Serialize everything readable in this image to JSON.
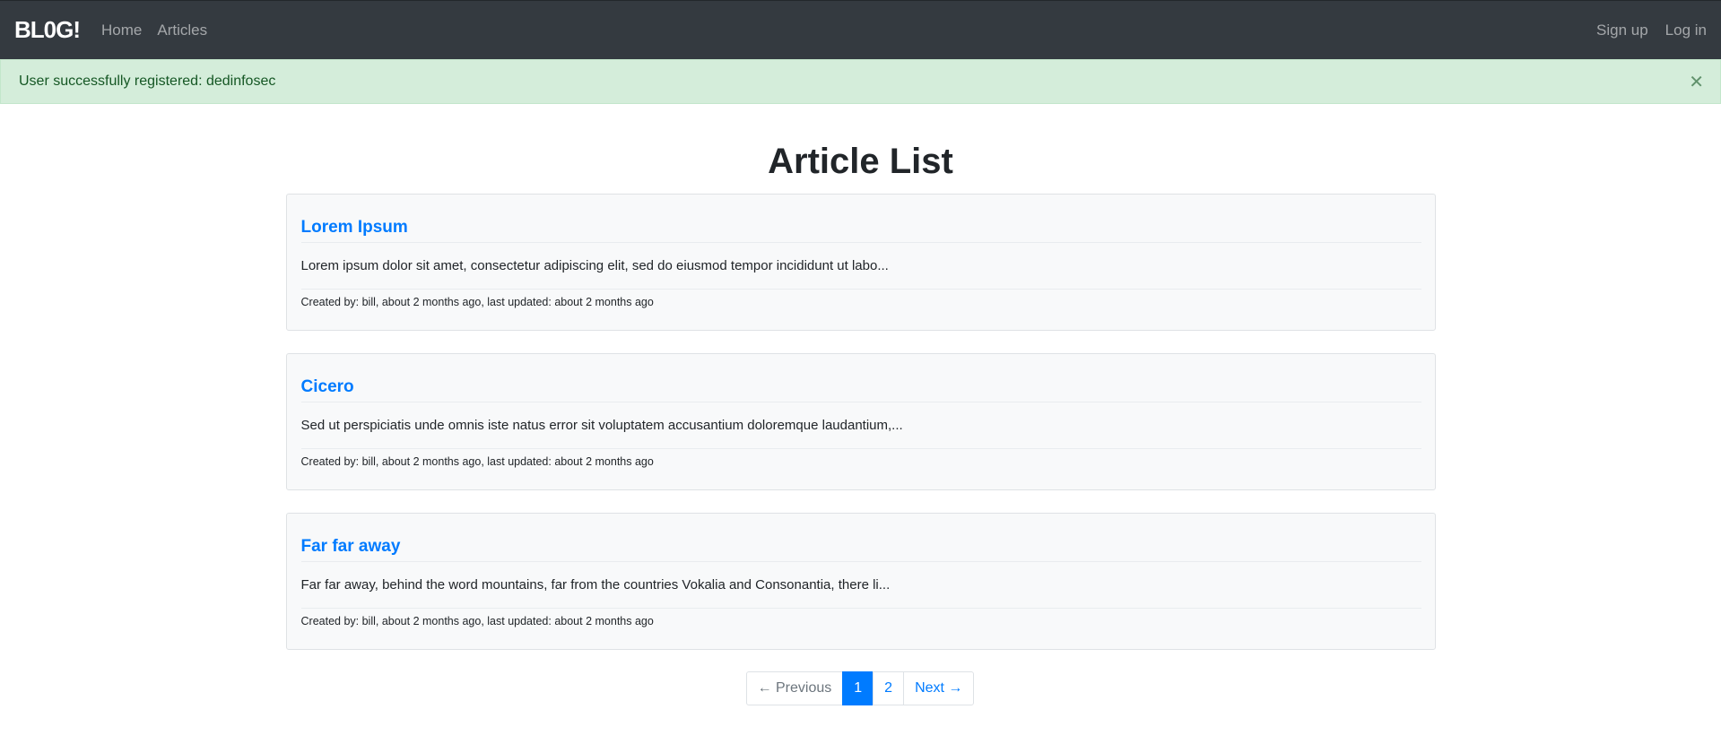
{
  "navbar": {
    "brand": "BL0G!",
    "left_links": [
      "Home",
      "Articles"
    ],
    "right_links": [
      "Sign up",
      "Log in"
    ]
  },
  "alert": {
    "message": "User successfully registered: dedinfosec",
    "close_glyph": "✕"
  },
  "main": {
    "title": "Article List",
    "articles": [
      {
        "title": "Lorem Ipsum",
        "excerpt": "Lorem ipsum dolor sit amet, consectetur adipiscing elit, sed do eiusmod tempor incididunt ut labo...",
        "meta": "Created by: bill, about 2 months ago, last updated: about 2 months ago"
      },
      {
        "title": "Cicero",
        "excerpt": "Sed ut perspiciatis unde omnis iste natus error sit voluptatem accusantium doloremque laudantium,...",
        "meta": "Created by: bill, about 2 months ago, last updated: about 2 months ago"
      },
      {
        "title": "Far far away",
        "excerpt": "Far far away, behind the word mountains, far from the countries Vokalia and Consonantia, there li...",
        "meta": "Created by: bill, about 2 months ago, last updated: about 2 months ago"
      }
    ]
  },
  "pagination": {
    "previous": "← Previous",
    "pages": [
      "1",
      "2"
    ],
    "current": "1",
    "next": "Next →"
  },
  "colors": {
    "navbar_bg": "#343a40",
    "alert_bg": "#d4edda",
    "alert_text": "#155724",
    "link": "#007bff",
    "card_bg": "#f8f9fa"
  }
}
